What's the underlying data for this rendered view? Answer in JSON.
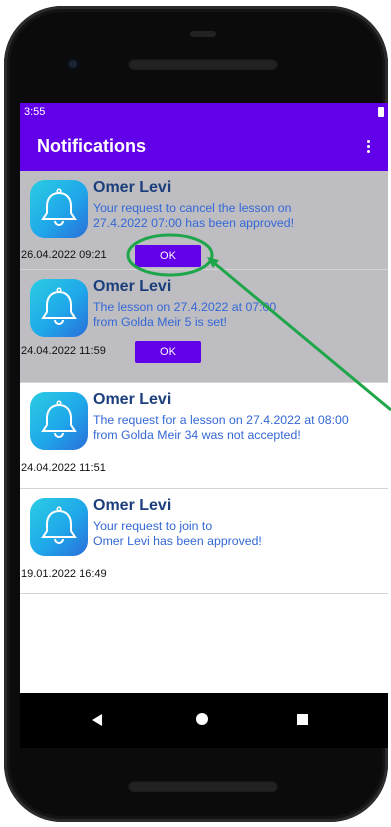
{
  "status_bar": {
    "time": "3:55"
  },
  "app_bar": {
    "title": "Notifications"
  },
  "notifications": [
    {
      "sender": "Omer Levi",
      "message": "Your request to cancel the lesson on\n27.4.2022 07:00 has been approved!",
      "datetime": "26.04.2022 09:21",
      "action_label": "OK",
      "state": "unread"
    },
    {
      "sender": "Omer Levi",
      "message": "The lesson on 27.4.2022 at 07:00\nfrom Golda Meir 5 is set!",
      "datetime": "24.04.2022 11:59",
      "action_label": "OK",
      "state": "unread"
    },
    {
      "sender": "Omer Levi",
      "message": "The request for a lesson on 27.4.2022 at 08:00\nfrom Golda Meir 34 was not accepted!",
      "datetime": "24.04.2022 11:51",
      "state": "read"
    },
    {
      "sender": "Omer Levi",
      "message": "Your request to join to\nOmer Levi has been approved!",
      "datetime": "19.01.2022 16:49",
      "state": "read"
    }
  ],
  "colors": {
    "primary": "#6200ea",
    "unread_background": "#bdbdc2",
    "sender_text": "#1c3f7c",
    "message_text": "#3468d6",
    "annotation": "#1fa64a"
  },
  "icons": {
    "notification_avatar": "bell-icon",
    "overflow_menu": "more-vert-icon"
  }
}
